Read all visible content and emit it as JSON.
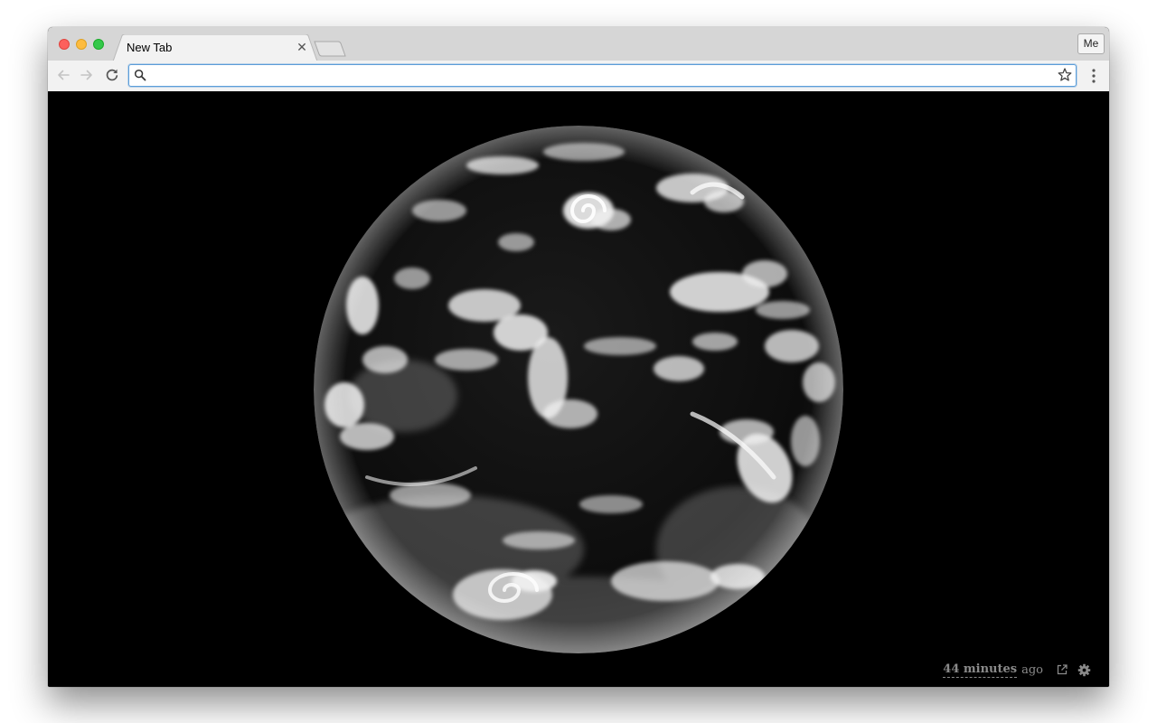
{
  "tabs": [
    {
      "title": "New Tab",
      "active": true
    }
  ],
  "profile": {
    "label": "Me"
  },
  "omnibox": {
    "value": "",
    "placeholder": ""
  },
  "icons": {
    "back": "arrow-left-icon",
    "forward": "arrow-right-icon",
    "reload": "reload-icon",
    "search": "search-icon",
    "bookmark": "star-icon",
    "menu": "kebab-menu-icon",
    "close_tab": "close-icon",
    "open_external": "external-link-icon",
    "settings": "gear-icon"
  },
  "content": {
    "updated": {
      "relative_time": "44 minutes",
      "suffix": "ago"
    }
  },
  "colors": {
    "traffic_close": "#fc605c",
    "traffic_minimize": "#fdbc40",
    "traffic_maximize": "#34c84a",
    "omnibox_focus": "#5b9dd9",
    "page_background": "#000000"
  }
}
